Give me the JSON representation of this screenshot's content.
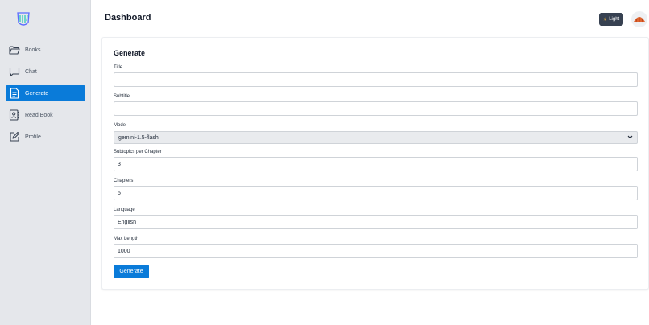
{
  "app": {
    "logo_icon": "app-logo-icon"
  },
  "sidebar": {
    "items": [
      {
        "label": "Books",
        "icon": "folder-open-icon",
        "active": false
      },
      {
        "label": "Chat",
        "icon": "chat-bubble-icon",
        "active": false
      },
      {
        "label": "Generate",
        "icon": "document-icon",
        "active": true
      },
      {
        "label": "Read Book",
        "icon": "contact-book-icon",
        "active": false
      },
      {
        "label": "Profile",
        "icon": "edit-icon",
        "active": false
      }
    ]
  },
  "header": {
    "title": "Dashboard",
    "theme_label": "Light",
    "theme_icon": "sun-icon",
    "avatar_icon": "avatar-icon"
  },
  "form": {
    "title": "Generate",
    "title_label": "Title",
    "title_value": "",
    "subtitle_label": "Subtitle",
    "subtitle_value": "",
    "model_label": "Model",
    "model_value": "gemini-1.5-flash",
    "subtopics_label": "Subtopics per Chapter",
    "subtopics_value": "3",
    "chapters_label": "Chapters",
    "chapters_value": "5",
    "language_label": "Language",
    "language_value": "English",
    "max_length_label": "Max Length",
    "max_length_value": "1000",
    "submit_label": "Generate"
  },
  "colors": {
    "accent": "#0a7bd9",
    "sidebar_bg": "#e5e7eb",
    "theme_button_bg": "#374151"
  }
}
